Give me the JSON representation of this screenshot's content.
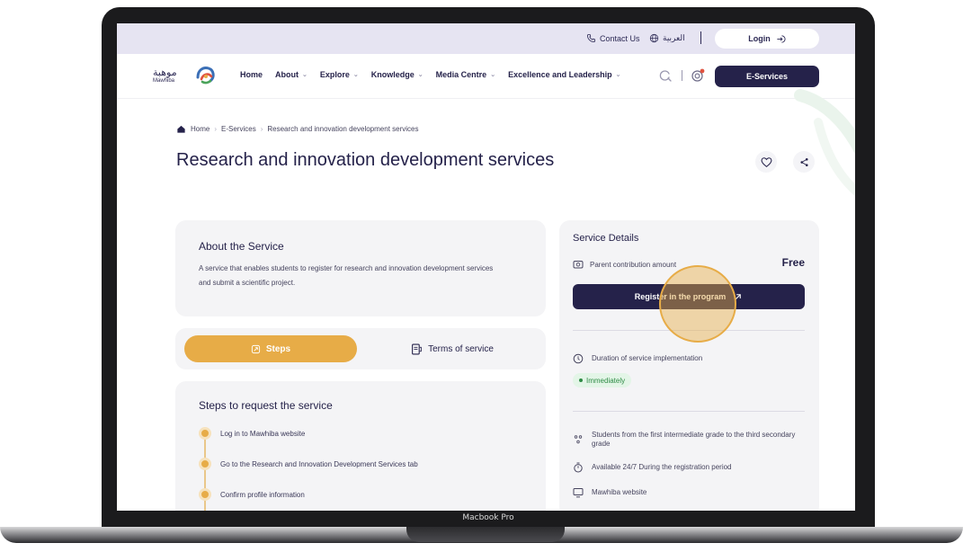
{
  "device": {
    "label": "Macbook Pro"
  },
  "topbar": {
    "contact_label": "Contact Us",
    "language_label": "العربية",
    "login_label": "Login"
  },
  "logo": {
    "arabic": "موهبة",
    "english": "Mawhiba"
  },
  "nav": {
    "items": [
      {
        "label": "Home",
        "has_dropdown": false
      },
      {
        "label": "About",
        "has_dropdown": true
      },
      {
        "label": "Explore",
        "has_dropdown": true
      },
      {
        "label": "Knowledge",
        "has_dropdown": true
      },
      {
        "label": "Media Centre",
        "has_dropdown": true
      },
      {
        "label": "Excellence and Leadership",
        "has_dropdown": true
      }
    ],
    "eservices_label": "E-Services"
  },
  "breadcrumb": {
    "home": "Home",
    "eservices": "E-Services",
    "current": "Research and innovation development services"
  },
  "page_title": "Research and innovation development services",
  "about": {
    "title": "About the Service",
    "description": "A service that enables students to register for research and innovation development services and submit a scientific project."
  },
  "tabs": {
    "steps_label": "Steps",
    "terms_label": "Terms of service"
  },
  "steps": {
    "title": "Steps to request the service",
    "items": [
      "Log in to Mawhiba website",
      "Go to the Research and Innovation Development Services tab",
      "Confirm profile information"
    ]
  },
  "details": {
    "title": "Service Details",
    "fee_label": "Parent contribution amount",
    "fee_value": "Free",
    "register_label": "Register in the program",
    "duration_label": "Duration of service implementation",
    "duration_badge": "Immediately",
    "audience": "Students from the first intermediate grade to the third secondary grade",
    "availability": "Available 24/7 During the registration period",
    "channel": "Mawhiba website"
  },
  "colors": {
    "primary": "#25224a",
    "accent": "#e7ac47",
    "topbar_bg": "#e6e4f2",
    "card_bg": "#f4f4f6",
    "success": "#2e8b45"
  }
}
